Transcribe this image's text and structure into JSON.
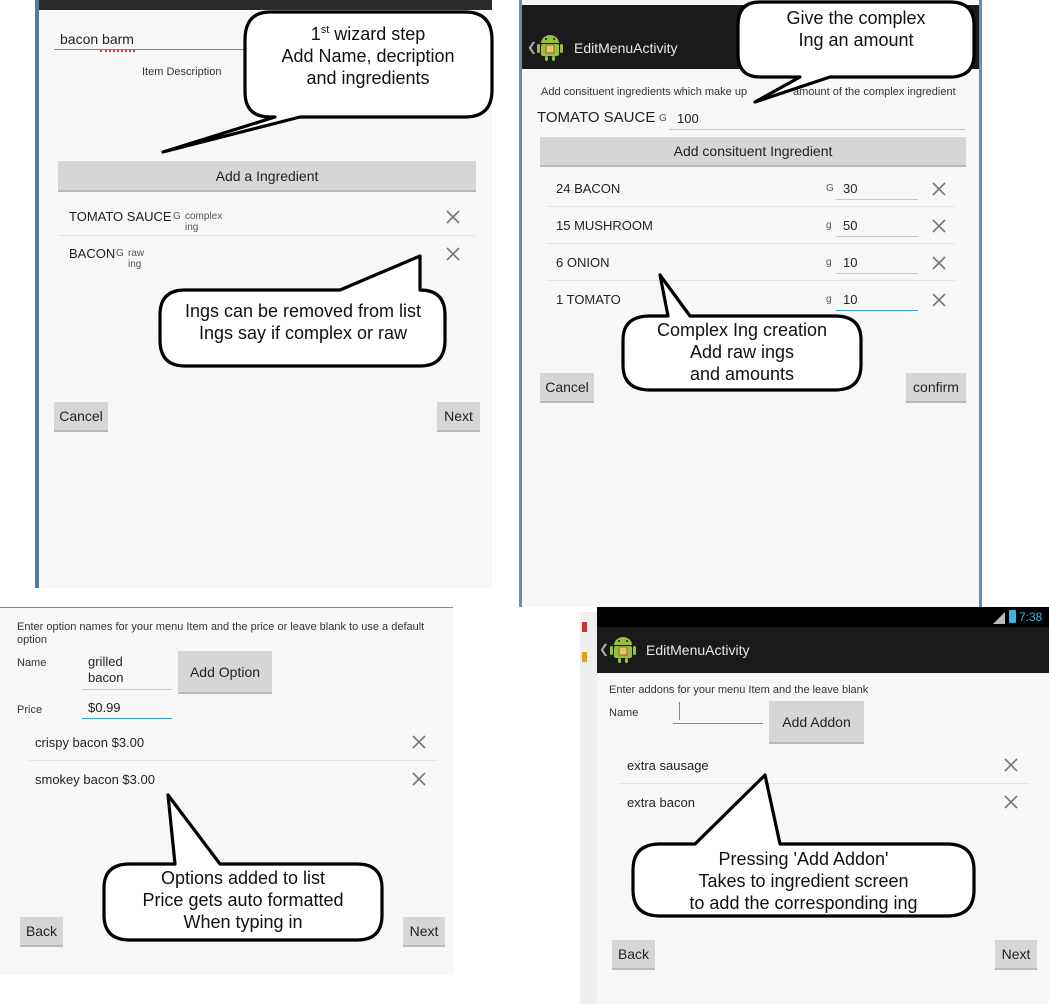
{
  "panel1": {
    "name_value": "bacon barm",
    "description_placeholder": "Item Description",
    "add_ingredient_label": "Add a Ingredient",
    "ingredients": [
      {
        "name": "TOMATO SAUCE",
        "unit": "G",
        "kind": "complex ing"
      },
      {
        "name": "BACON",
        "unit": "G",
        "kind": "raw ing"
      }
    ],
    "cancel_label": "Cancel",
    "next_label": "Next"
  },
  "panel2": {
    "title": "EditMenuActivity",
    "instructions": "Add consituent ingredients which make up",
    "instructions_tail": "amount of the complex ingredient",
    "complex_name": "TOMATO SAUCE",
    "complex_unit": "G",
    "complex_amount": "100",
    "add_constituent_label": "Add consituent Ingredient",
    "constituents": [
      {
        "name": "24 BACON",
        "unit": "G",
        "amount": "30"
      },
      {
        "name": "15 MUSHROOM",
        "unit": "g",
        "amount": "50"
      },
      {
        "name": "6 ONION",
        "unit": "g",
        "amount": "10"
      },
      {
        "name": "1 TOMATO",
        "unit": "g",
        "amount": "10"
      }
    ],
    "cancel_label": "Cancel",
    "confirm_label": "confirm"
  },
  "panel3": {
    "instructions": "Enter option names for your menu Item and the price or leave blank to use a default option",
    "name_label": "Name",
    "name_line1": "grilled",
    "name_line2": "bacon",
    "price_label": "Price",
    "price_value": "$0.99",
    "add_option_label": "Add Option",
    "options": [
      {
        "text": "crispy bacon  $3.00"
      },
      {
        "text": "smokey bacon  $3.00"
      }
    ],
    "back_label": "Back",
    "next_label": "Next"
  },
  "panel4": {
    "status_time": "7:38",
    "title": "EditMenuActivity",
    "instructions": "Enter addons for your menu Item and the leave blank",
    "name_label": "Name",
    "add_addon_label": "Add Addon",
    "addons": [
      {
        "text": "extra sausage"
      },
      {
        "text": "extra bacon"
      }
    ],
    "back_label": "Back",
    "next_label": "Next"
  },
  "callouts": {
    "wizard_step": {
      "line1_num": "1",
      "line1_sup": "st",
      "line1_rest": " wizard step",
      "line2": "Add Name, decription",
      "line3": "and ingredients"
    },
    "removed": {
      "line1": "Ings can be removed from list",
      "line2": "Ings say if complex or raw"
    },
    "give_amount": {
      "line1": "Give the complex",
      "line2": "Ing an amount"
    },
    "complex_creation": {
      "line1": "Complex Ing creation",
      "line2": "Add raw ings",
      "line3": "and amounts"
    },
    "options_added": {
      "line1": "Options added to list",
      "line2": "Price gets auto formatted",
      "line3": "When typing in"
    },
    "pressing_addon": {
      "line1": "Pressing 'Add Addon'",
      "line2": "Takes to ingredient screen",
      "line3": "to add the corresponding ing"
    }
  },
  "colors": {
    "accent": "#33a6d8",
    "button": "#d6d6d6",
    "background": "#f7f7f7",
    "actionbar": "#1a1a1a",
    "android_green": "#97c03e"
  }
}
